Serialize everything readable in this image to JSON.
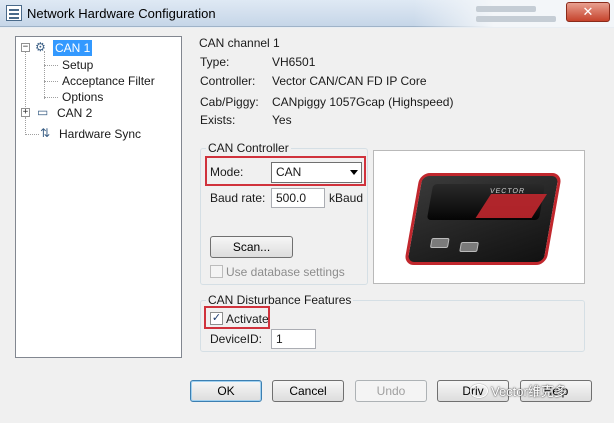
{
  "window": {
    "title": "Network Hardware Configuration",
    "close_glyph": "✕"
  },
  "tree": {
    "items": [
      {
        "label": "CAN 1",
        "expander": "−",
        "icon": "can-device-icon"
      },
      {
        "label": "Setup"
      },
      {
        "label": "Acceptance Filter"
      },
      {
        "label": "Options"
      },
      {
        "label": "CAN 2",
        "expander": "+",
        "icon": "computer-icon"
      },
      {
        "label": "Hardware Sync",
        "icon": "sync-icon"
      }
    ]
  },
  "channel": {
    "title": "CAN channel 1",
    "type_label": "Type:",
    "type_value": "VH6501",
    "controller_label": "Controller:",
    "controller_value": "Vector CAN/CAN FD IP Core",
    "piggy_label": "Cab/Piggy:",
    "piggy_value": "CANpiggy 1057Gcap (Highspeed)",
    "exists_label": "Exists:",
    "exists_value": "Yes"
  },
  "can_controller": {
    "legend": "CAN Controller",
    "mode_label": "Mode:",
    "mode_value": "CAN",
    "baud_label": "Baud rate:",
    "baud_value": "500.0",
    "baud_unit": "kBaud",
    "scan_label": "Scan...",
    "use_db_label": "Use database settings",
    "use_db_checked": false
  },
  "disturbance": {
    "legend": "CAN Disturbance Features",
    "activate_label": "Activate",
    "activate_checked": true,
    "activate_glyph": "✓",
    "device_label": "DeviceID:",
    "device_value": "1"
  },
  "device_image": {
    "brand": "VECTOR"
  },
  "buttons": {
    "ok": "OK",
    "cancel": "Cancel",
    "undo": "Undo",
    "driver": "Driv",
    "help": "Help"
  },
  "watermark": {
    "text": "Vector维克多"
  },
  "colors": {
    "highlight": "#d0323c",
    "selection": "#3399ff",
    "device_accent": "#c1272d"
  }
}
